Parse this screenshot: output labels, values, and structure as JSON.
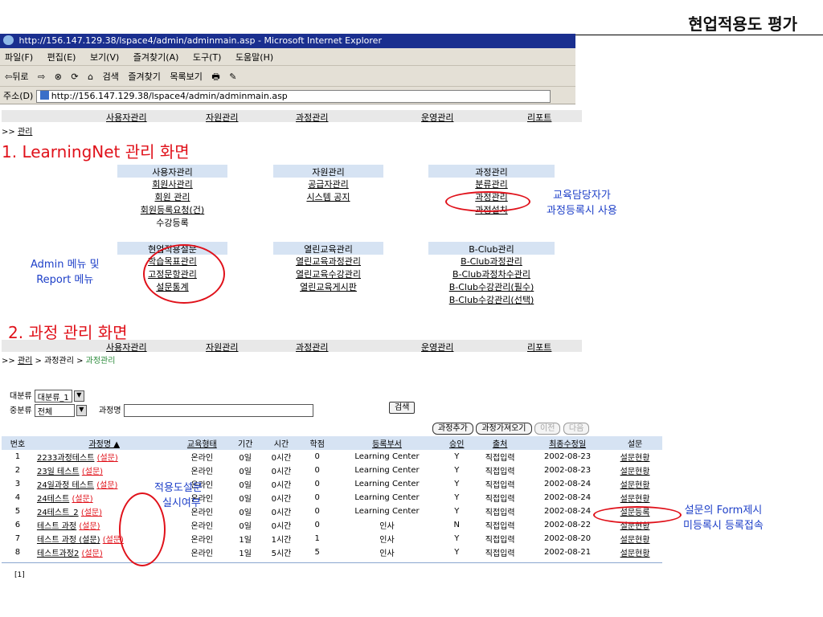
{
  "slide_title": "현업적용도 평가",
  "browser": {
    "title": "http://156.147.129.38/lspace4/admin/adminmain.asp - Microsoft Internet Explorer",
    "menu": [
      "파일(F)",
      "편집(E)",
      "보기(V)",
      "즐겨찾기(A)",
      "도구(T)",
      "도움말(H)"
    ],
    "toolbar": [
      "⇦뒤로",
      "⇨",
      "⊗",
      "⟳",
      "⌂",
      "검색",
      "즐겨찾기",
      "목록보기"
    ],
    "address_label": "주소(D)",
    "address": "http://156.147.129.38/lspace4/admin/adminmain.asp"
  },
  "nav": [
    "사용자관리",
    "자원관리",
    "과정관리",
    "운영관리",
    "리포트"
  ],
  "section1": {
    "breadcrumb_prefix": ">>",
    "breadcrumb_link": "관리",
    "heading": "1. LearningNet 관리 화면",
    "groups": {
      "user": {
        "head": "사용자관리",
        "items": [
          "회원사관리",
          "회원 관리",
          "회원등록요청(건)"
        ],
        "plain": "수강등록"
      },
      "resource": {
        "head": "자원관리",
        "items": [
          "공급자관리",
          "시스템 공지"
        ]
      },
      "course": {
        "head": "과정관리",
        "items": [
          "분류관리",
          "과정관리",
          "과정설치"
        ]
      },
      "survey": {
        "head": "현업적용설문",
        "items": [
          "학습목표관리",
          "고정문항관리",
          "설문통계"
        ]
      },
      "open": {
        "head": "열린교육관리",
        "items": [
          "열린교육과정관리",
          "열린교육수강관리",
          "열린교육게시판"
        ]
      },
      "bclub": {
        "head": "B-Club관리",
        "items": [
          "B-Club과정관리",
          "B-Club과정차수관리",
          "B-Club수강관리(필수)",
          "B-Club수강관리(선택)"
        ]
      }
    },
    "annotation_right": [
      "교육담당자가",
      "과정등록시 사용"
    ],
    "annotation_left": [
      "Admin 메뉴 및",
      "Report 메뉴"
    ]
  },
  "section2": {
    "heading": "2. 과정 관리 화면",
    "breadcrumb": {
      "prefix": ">>",
      "link": "관리",
      "mid": "> 과정관리 >",
      "current": "과정관리"
    },
    "filter": {
      "major_label": "대분류",
      "major_value": "대분류_1",
      "middle_label": "중분류",
      "middle_value": "전체",
      "name_label": "과정명",
      "name_value": "",
      "search": "검색"
    },
    "buttons": {
      "add": "과정추가",
      "import": "과정가져오기",
      "prev": "이전",
      "next": "다음"
    },
    "columns": [
      "번호",
      "과정명 ▲",
      "교육형태",
      "기간",
      "시간",
      "학점",
      "등록부서",
      "승인",
      "출처",
      "최종수정일",
      "설문"
    ],
    "rows": [
      {
        "no": "1",
        "name": "2233과정테스트",
        "survey_tag": "(설문)",
        "type": "온라인",
        "period": "0일",
        "hours": "0시간",
        "credit": "0",
        "dept": "Learning Center",
        "approve": "Y",
        "source": "직접입력",
        "date": "2002-08-23",
        "survey": "설문현황"
      },
      {
        "no": "2",
        "name": "23일 테스트",
        "survey_tag": "(설문)",
        "type": "온라인",
        "period": "0일",
        "hours": "0시간",
        "credit": "0",
        "dept": "Learning Center",
        "approve": "Y",
        "source": "직접입력",
        "date": "2002-08-23",
        "survey": "설문현황"
      },
      {
        "no": "3",
        "name": "24일과정 테스트",
        "survey_tag": "(설문)",
        "type": "온라인",
        "period": "0일",
        "hours": "0시간",
        "credit": "0",
        "dept": "Learning Center",
        "approve": "Y",
        "source": "직접입력",
        "date": "2002-08-24",
        "survey": "설문현황"
      },
      {
        "no": "4",
        "name": "24테스트",
        "survey_tag": "(설문)",
        "type": "온라인",
        "period": "0일",
        "hours": "0시간",
        "credit": "0",
        "dept": "Learning Center",
        "approve": "Y",
        "source": "직접입력",
        "date": "2002-08-24",
        "survey": "설문현황"
      },
      {
        "no": "5",
        "name": "24테스트_2",
        "survey_tag": "(설문)",
        "type": "온라인",
        "period": "0일",
        "hours": "0시간",
        "credit": "0",
        "dept": "Learning Center",
        "approve": "Y",
        "source": "직접입력",
        "date": "2002-08-24",
        "survey": "설문등록"
      },
      {
        "no": "6",
        "name": "테스트 과정",
        "survey_tag": "(설문)",
        "type": "온라인",
        "period": "0일",
        "hours": "0시간",
        "credit": "0",
        "dept": "인사",
        "approve": "N",
        "source": "직접입력",
        "date": "2002-08-22",
        "survey": "설문현황"
      },
      {
        "no": "7",
        "name": "테스트 과정 (설문)",
        "survey_tag": "(설문)",
        "type": "온라인",
        "period": "1일",
        "hours": "1시간",
        "credit": "1",
        "dept": "인사",
        "approve": "Y",
        "source": "직접입력",
        "date": "2002-08-20",
        "survey": "설문현황"
      },
      {
        "no": "8",
        "name": "테스트과정2",
        "survey_tag": "(설문)",
        "type": "온라인",
        "period": "1일",
        "hours": "5시간",
        "credit": "5",
        "dept": "인사",
        "approve": "Y",
        "source": "직접입력",
        "date": "2002-08-21",
        "survey": "설문현황"
      }
    ],
    "pager": "[1]",
    "annotation_middle": [
      "적용도설문",
      "실시여부"
    ],
    "annotation_right": [
      "설문의 Form제시",
      "미등록시 등록접속"
    ]
  }
}
